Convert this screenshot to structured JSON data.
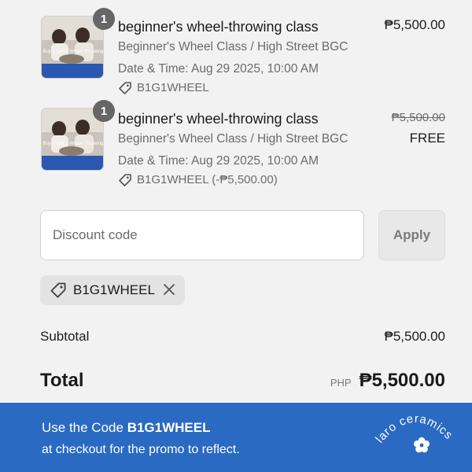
{
  "items": [
    {
      "quantity": "1",
      "title": "beginner's wheel-throwing class",
      "variant": "Beginner's Wheel Class / High Street BGC",
      "date": "Date & Time: Aug 29 2025, 10:00 AM",
      "code": "B1G1WHEEL",
      "price": "₱5,500.00",
      "thumb_text": "Buy 1 Get 1 Wheel Throwing"
    },
    {
      "quantity": "1",
      "title": "beginner's wheel-throwing class",
      "variant": "Beginner's Wheel Class / High Street BGC",
      "date": "Date & Time: Aug 29 2025, 10:00 AM",
      "code": "B1G1WHEEL (-₱5,500.00)",
      "price_old": "₱5,500.00",
      "price_new": "FREE",
      "thumb_text": "Buy 1 Get 1 Wheel Throwing"
    }
  ],
  "discount": {
    "placeholder": "Discount code",
    "apply_label": "Apply",
    "applied_code": "B1G1WHEEL"
  },
  "summary": {
    "subtotal_label": "Subtotal",
    "subtotal_value": "₱5,500.00",
    "total_label": "Total",
    "total_currency": "PHP",
    "total_value": "₱5,500.00"
  },
  "banner": {
    "line1_prefix": "Use the Code ",
    "line1_code": "B1G1WHEEL",
    "line2": "at checkout for the promo to reflect.",
    "brand": "laro ceramics",
    "bg_color": "#2a6ac3"
  },
  "icons": {
    "tag": "tag-icon",
    "close": "close-icon",
    "flower": "flower-icon"
  }
}
